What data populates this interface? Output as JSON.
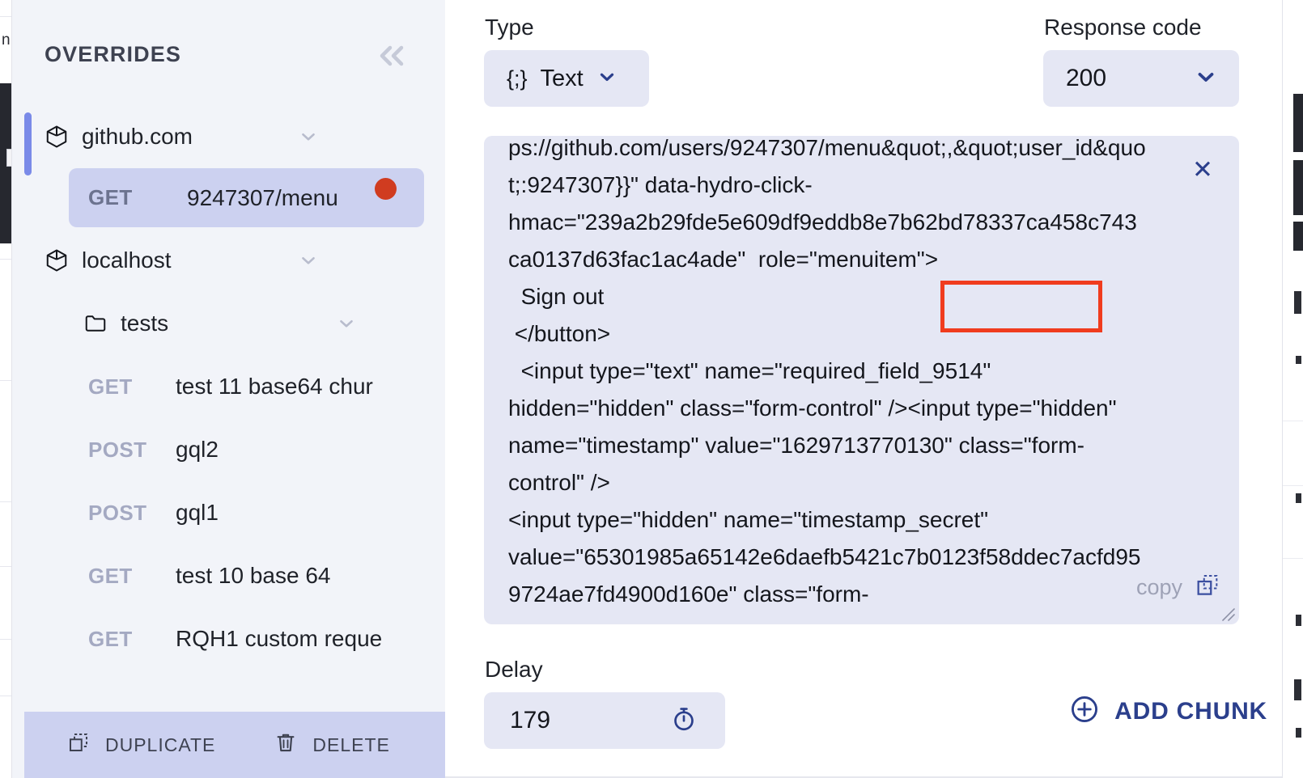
{
  "sidebar": {
    "title": "OVERRIDES",
    "collapse_icon": "double-chevron-left-icon",
    "tree": [
      {
        "kind": "host",
        "label": "github.com",
        "icon": "cube-icon",
        "chevron": "chevron-down-icon",
        "active": true
      },
      {
        "kind": "request",
        "verb": "GET",
        "name": "9247307/menu",
        "selected": true,
        "has_dot": true
      },
      {
        "kind": "host",
        "label": "localhost",
        "icon": "cube-icon",
        "chevron": "chevron-down-icon",
        "active": false
      },
      {
        "kind": "folder",
        "label": "tests",
        "icon": "folder-icon",
        "chevron": "chevron-down-icon"
      },
      {
        "kind": "request",
        "verb": "GET",
        "name": "test 11 base64 chur",
        "selected": false,
        "has_dot": false
      },
      {
        "kind": "request",
        "verb": "POST",
        "name": "gql2",
        "selected": false,
        "has_dot": false
      },
      {
        "kind": "request",
        "verb": "POST",
        "name": "gql1",
        "selected": false,
        "has_dot": false
      },
      {
        "kind": "request",
        "verb": "GET",
        "name": "test 10 base 64",
        "selected": false,
        "has_dot": false
      },
      {
        "kind": "request",
        "verb": "GET",
        "name": "RQH1 custom reque",
        "selected": false,
        "has_dot": false
      }
    ],
    "footer": {
      "duplicate_label": "DUPLICATE",
      "duplicate_icon": "duplicate-icon",
      "delete_label": "DELETE",
      "delete_icon": "trash-icon"
    }
  },
  "main": {
    "type_field": {
      "label": "Type",
      "icon": "{;}",
      "value": "Text",
      "chevron": "chevron-down-icon"
    },
    "response_code_field": {
      "label": "Response code",
      "value": "200",
      "chevron": "chevron-down-icon"
    },
    "chunk": {
      "body": "ps://github.com/users/9247307/menu&quot;,&quot;user_id&quot;:9247307}}\" data-hydro-click-hmac=\"239a2b29fde5e609df9eddb8e7b62bd78337ca458c743ca0137d63fac1ac4ade\"  role=\"menuitem\">\n  Sign out\n </button>\n  <input type=\"text\" name=\"required_field_9514\" hidden=\"hidden\" class=\"form-control\" /><input type=\"hidden\" name=\"timestamp\" value=\"1629713770130\" class=\"form-control\" />\n<input type=\"hidden\" name=\"timestamp_secret\" value=\"65301985a65142e6daefb5421c7b0123f58ddec7acfd959724ae7fd4900d160e\" class=\"form-",
      "close_icon": "close-icon",
      "copy_label": "copy",
      "copy_icon": "copy-icon",
      "resize_icon": "resize-handle-icon",
      "highlight_target": "Sign out"
    },
    "delay_field": {
      "label": "Delay",
      "value": "179",
      "icon": "stopwatch-icon"
    },
    "add_chunk": {
      "label": "ADD CHUNK",
      "icon": "plus-circle-icon"
    }
  },
  "colors": {
    "sidebar_bg": "#f2f4f9",
    "selected_row": "#ccd1f0",
    "field_bg": "#e5e7f4",
    "accent": "#2b3f8c",
    "active_marker": "#7a8ae8",
    "dot": "#d03c20",
    "highlight": "#f03c1e"
  }
}
